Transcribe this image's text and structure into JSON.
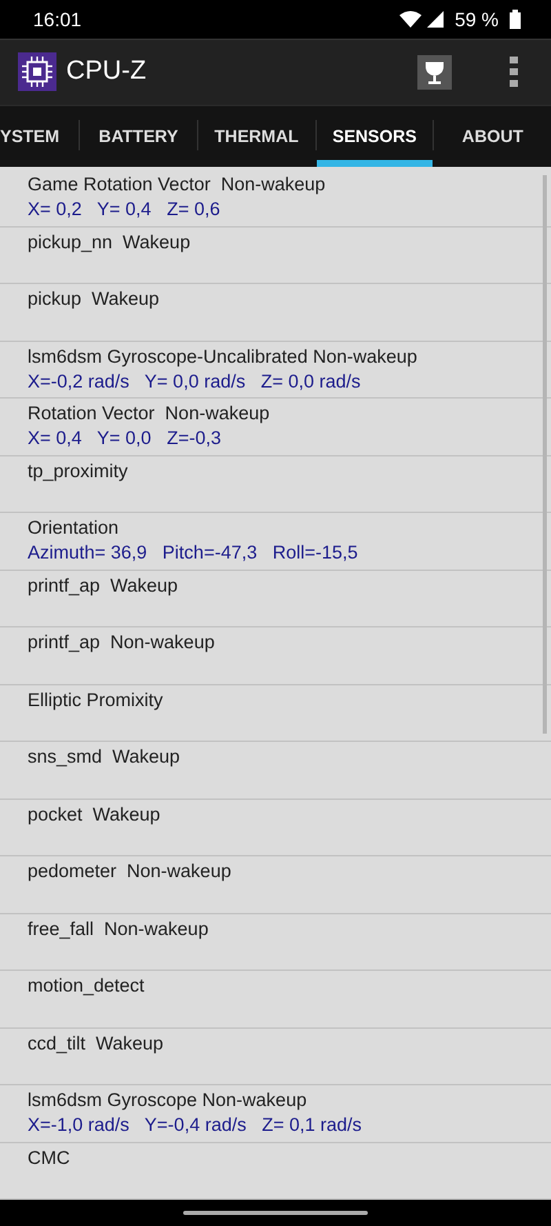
{
  "status_bar": {
    "time": "16:01",
    "battery": "59 %"
  },
  "app_bar": {
    "title": "CPU-Z"
  },
  "tabs": [
    {
      "label": "YSTEM",
      "selected": false
    },
    {
      "label": "BATTERY",
      "selected": false
    },
    {
      "label": "THERMAL",
      "selected": false
    },
    {
      "label": "SENSORS",
      "selected": true
    },
    {
      "label": "ABOUT",
      "selected": false
    }
  ],
  "sensors": [
    {
      "name": "Game Rotation Vector  Non-wakeup",
      "reading": "X= 0,2   Y= 0,4   Z= 0,6"
    },
    {
      "name": "pickup_nn  Wakeup"
    },
    {
      "name": "pickup  Wakeup"
    },
    {
      "name": "lsm6dsm Gyroscope-Uncalibrated Non-wakeup",
      "reading": "X=-0,2 rad/s   Y= 0,0 rad/s   Z= 0,0 rad/s"
    },
    {
      "name": "Rotation Vector  Non-wakeup",
      "reading": "X= 0,4   Y= 0,0   Z=-0,3"
    },
    {
      "name": "tp_proximity"
    },
    {
      "name": "Orientation",
      "reading": "Azimuth= 36,9   Pitch=-47,3   Roll=-15,5"
    },
    {
      "name": "printf_ap  Wakeup"
    },
    {
      "name": "printf_ap  Non-wakeup"
    },
    {
      "name": "Elliptic Promixity"
    },
    {
      "name": "sns_smd  Wakeup"
    },
    {
      "name": "pocket  Wakeup"
    },
    {
      "name": "pedometer  Non-wakeup"
    },
    {
      "name": "free_fall  Non-wakeup"
    },
    {
      "name": "motion_detect"
    },
    {
      "name": "ccd_tilt  Wakeup"
    },
    {
      "name": "lsm6dsm Gyroscope Non-wakeup",
      "reading": "X=-1,0 rad/s   Y=-0,4 rad/s   Z= 0,1 rad/s"
    },
    {
      "name": "CMC"
    }
  ]
}
